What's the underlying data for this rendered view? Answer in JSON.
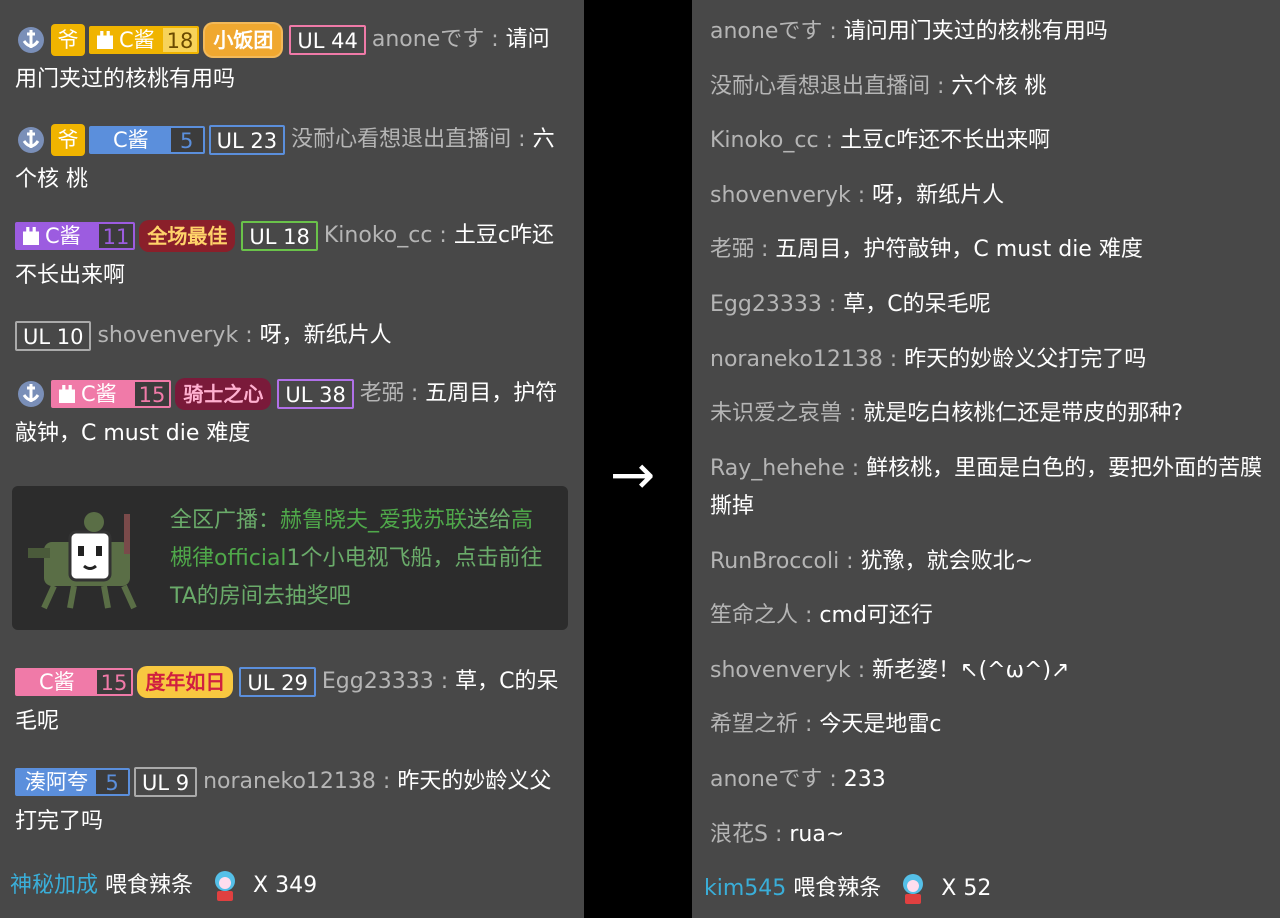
{
  "left": {
    "messages": [
      {
        "badge_name": "C酱",
        "badge_level": "18",
        "ul": "UL 44",
        "title_badge": "小饭团",
        "user": "anone",
        "user_cont": "です",
        "sep": " : ",
        "text": "请问用门夹过的核桃有用吗"
      },
      {
        "badge_name": "C酱",
        "badge_level": "5",
        "ul": "UL 23",
        "user": "没耐心看想退出直播间",
        "sep": " : ",
        "text": "六个核 桃"
      },
      {
        "badge_name": "C酱",
        "badge_level": "11",
        "title_badge": "全场最佳",
        "ul": "UL 18",
        "user": "Kinoko_cc",
        "sep": " : ",
        "text": "土豆c咋还不长出来啊"
      },
      {
        "ul": "UL 10",
        "user": "shovenveryk",
        "sep": " : ",
        "text": "呀，新纸片人"
      },
      {
        "badge_name": "C酱",
        "badge_level": "15",
        "title_badge": "骑士之心",
        "ul": "UL 38",
        "user": "老弼",
        "sep": " : ",
        "text": "五周目，护符敲钟，C must die 难度"
      },
      {
        "badge_name": "C酱",
        "badge_level": "15",
        "title_badge": "度年如日",
        "ul": "UL 29",
        "user": "Egg23333",
        "sep": " : ",
        "text": "草，C的呆毛呢"
      },
      {
        "badge_name": "湊阿夸",
        "badge_level": "5",
        "ul": "UL 9",
        "user": "noraneko12138",
        "sep": " : ",
        "text": "昨天的妙龄义父打完了吗"
      }
    ],
    "ye_label": "爷",
    "broadcast": {
      "prefix": "全区广播：",
      "sender": "赫鲁晓夫_爱我苏联",
      "verb": "送给",
      "receiver": "高槻律official",
      "gift": "1个小电视飞船，点击前往TA的房间去抽奖吧"
    },
    "gift": {
      "giver": "神秘加成",
      "action": "喂食辣条",
      "count": "X 349"
    }
  },
  "arrow": "→",
  "right": {
    "messages": [
      {
        "user": "anoneです",
        "sep": " : ",
        "text": "请问用门夹过的核桃有用吗"
      },
      {
        "user": "没耐心看想退出直播间",
        "sep": " : ",
        "text": "六个核 桃"
      },
      {
        "user": "Kinoko_cc",
        "sep": " : ",
        "text": "土豆c咋还不长出来啊"
      },
      {
        "user": "shovenveryk",
        "sep": " : ",
        "text": "呀，新纸片人"
      },
      {
        "user": "老弼",
        "sep": " : ",
        "text": "五周目，护符敲钟，C must die 难度"
      },
      {
        "user": "Egg23333",
        "sep": " : ",
        "text": "草，C的呆毛呢"
      },
      {
        "user": "noraneko12138",
        "sep": " : ",
        "text": "昨天的妙龄义父打完了吗"
      },
      {
        "user": "未识爱之哀兽",
        "sep": " : ",
        "text": "就是吃白核桃仁还是带皮的那种?"
      },
      {
        "user": "Ray_hehehe",
        "sep": " : ",
        "text": "鲜核桃，里面是白色的，要把外面的苦膜撕掉"
      },
      {
        "user": "RunBroccoli",
        "sep": " : ",
        "text": "犹豫，就会败北~"
      },
      {
        "user": "笙命之人",
        "sep": " : ",
        "text": "cmd可还行"
      },
      {
        "user": "shovenveryk",
        "sep": " : ",
        "text": "新老婆！↖(^ω^)↗"
      },
      {
        "user": "希望之祈",
        "sep": " : ",
        "text": "今天是地雷c"
      },
      {
        "user": "anoneです",
        "sep": " : ",
        "text": "233"
      },
      {
        "user": "浪花S",
        "sep": " : ",
        "text": "rua~"
      }
    ],
    "gift": {
      "giver": "kim545",
      "action": "喂食辣条",
      "count": "X 52"
    }
  },
  "colors": {
    "panel_bg": "#484848",
    "username": "#b5b5b5",
    "broadcast_green": "#6aab6a",
    "gift_giver": "#3aaed8",
    "badge_yellow": "#f0b400",
    "badge_blue": "#5b8fdc",
    "badge_purple": "#9c5ce0",
    "badge_pink": "#f07aa8"
  },
  "icons": [
    "anchor-captain-icon",
    "ye-badge-icon",
    "castle-icon",
    "robot-ship-icon",
    "latiao-gift-icon",
    "arrow-right-icon"
  ]
}
